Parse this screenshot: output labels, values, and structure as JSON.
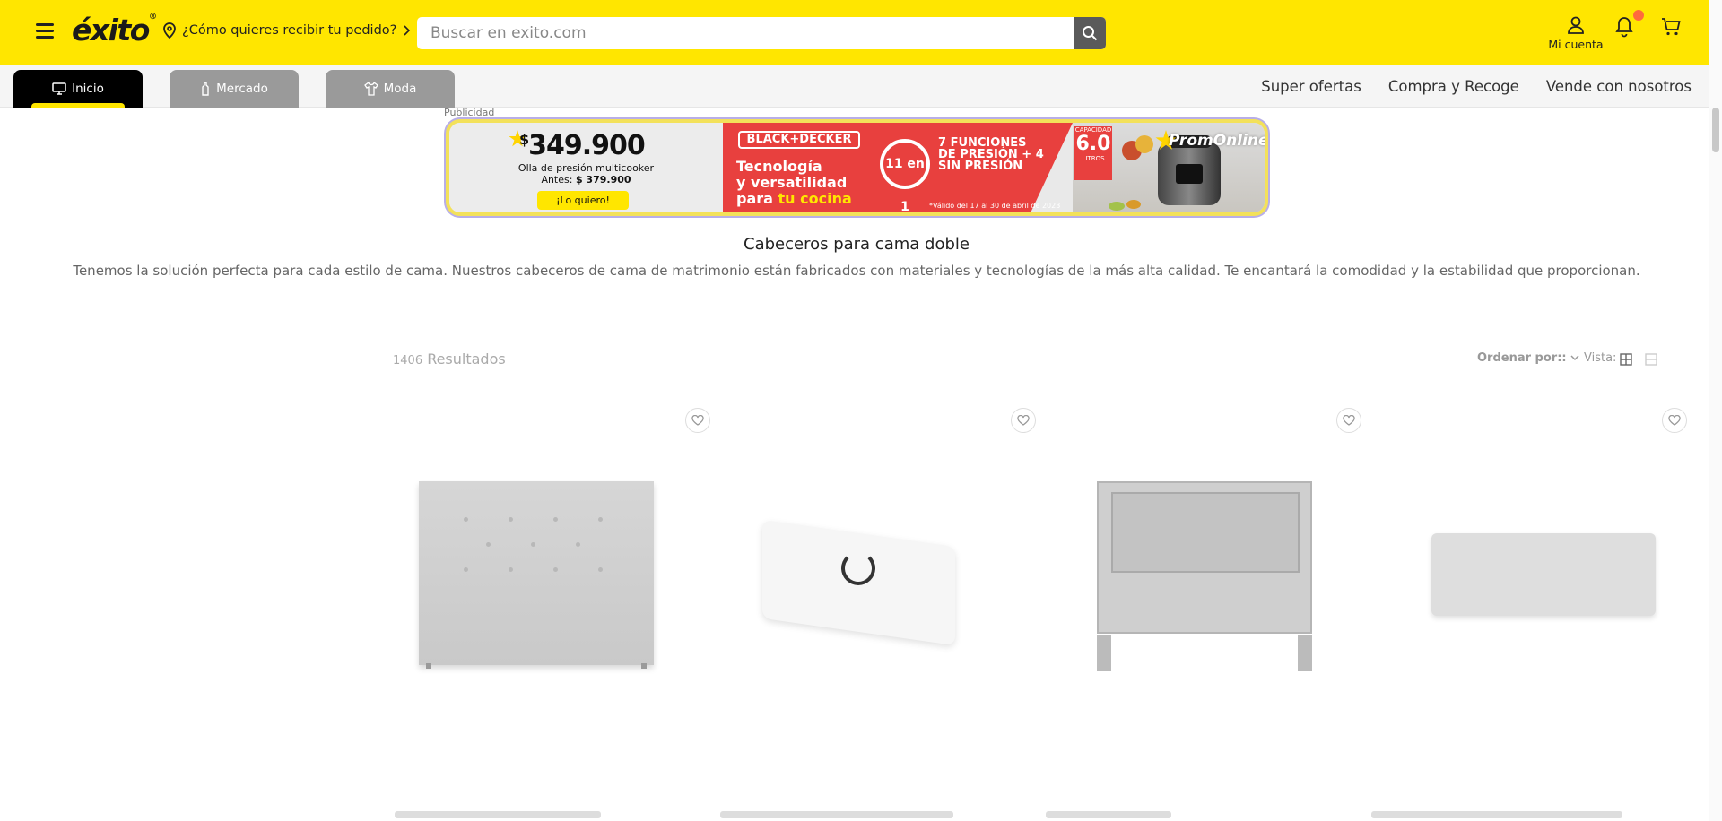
{
  "header": {
    "logo": "éxito",
    "delivery_label": "¿Cómo quieres recibir tu pedido?",
    "search_placeholder": "Buscar en exito.com",
    "account_label": "Mi cuenta",
    "brand_color": "#ffe600",
    "notification_color": "#ff6a3d"
  },
  "nav": {
    "tabs": [
      {
        "label": "Inicio",
        "icon": "monitor-icon",
        "active": true
      },
      {
        "label": "Mercado",
        "icon": "bottle-icon",
        "active": false
      },
      {
        "label": "Moda",
        "icon": "shirt-icon",
        "active": false
      }
    ],
    "links": [
      "Super ofertas",
      "Compra y Recoge",
      "Vende con nosotros"
    ]
  },
  "ad": {
    "label": "Publicidad",
    "price_symbol": "$",
    "price": "349.900",
    "product": "Olla de presión multicooker",
    "before_label": "Antes:",
    "before_price": "$ 379.900",
    "cta": "¡Lo quiero!",
    "brand": "BLACK+DECKER",
    "headline_1": "Tecnología",
    "headline_2": "y versatilidad",
    "headline_3": "para",
    "headline_highlight": "tu cocina",
    "badge": "11 en 1",
    "functions": "7 FUNCIONES DE PRESIÓN + 4 SIN PRESIÓN",
    "capacity_label": "CAPACIDAD",
    "capacity_value": "6.0",
    "capacity_unit": "LITROS",
    "promo": "PromOnline",
    "validity": "*Válido del 17 al 30 de abril de 2023"
  },
  "category": {
    "title": "Cabeceros para cama doble",
    "description": "Tenemos la solución perfecta para cada estilo de cama. Nuestros cabeceros de cama de matrimonio están fabricados con materiales y tecnologías de la más alta calidad. Te encantará la comodidad y la estabilidad que proporcionan."
  },
  "results": {
    "count": "1406",
    "label": "Resultados",
    "sort_label": "Ordenar por::",
    "view_label": "Vista:"
  },
  "products": [
    {
      "name": "headboard-1"
    },
    {
      "name": "headboard-2"
    },
    {
      "name": "headboard-3"
    },
    {
      "name": "headboard-4"
    }
  ]
}
